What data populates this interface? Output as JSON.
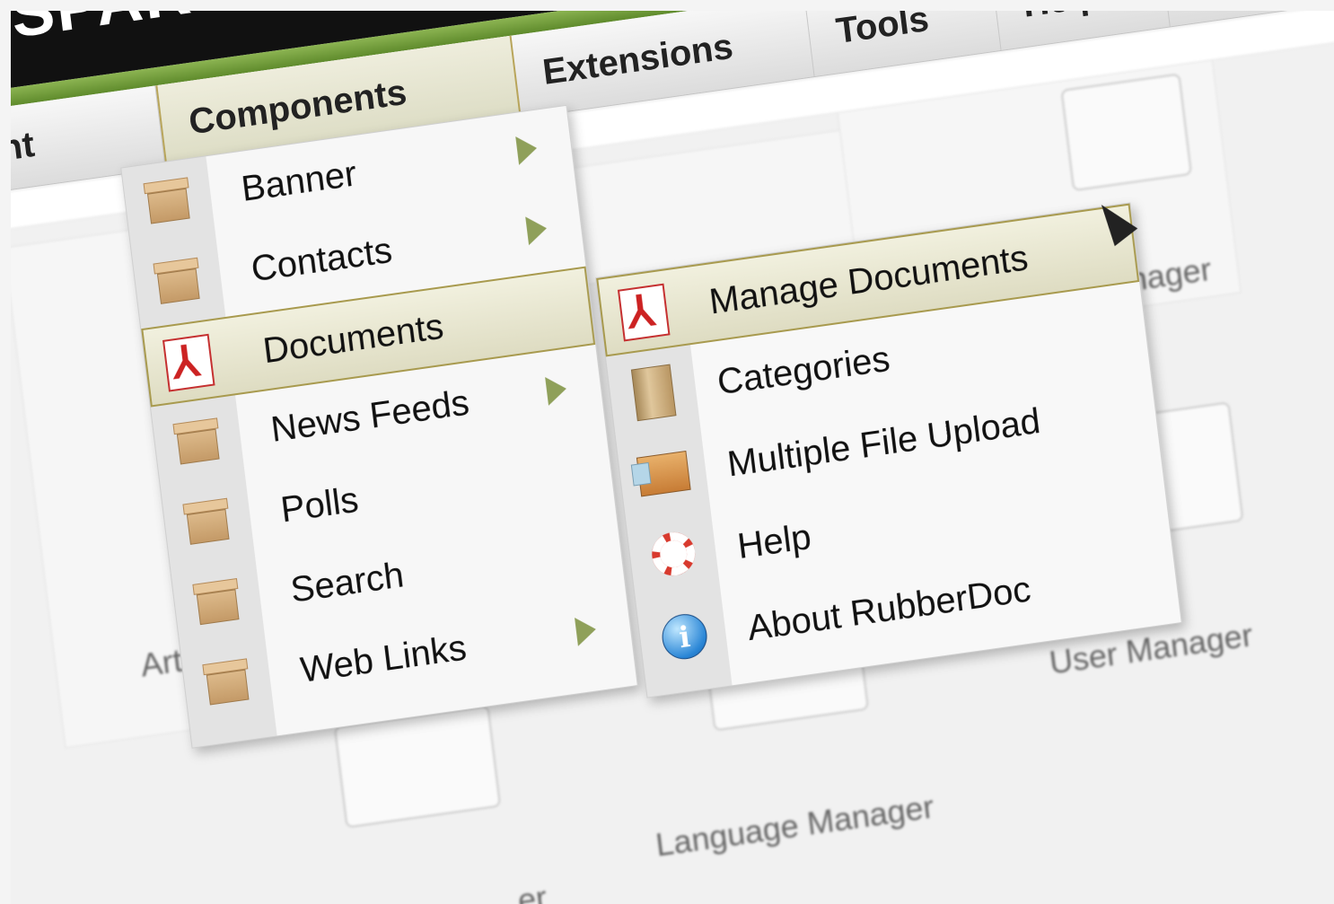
{
  "header": {
    "logo_text": "SPARC"
  },
  "menubar": {
    "items": [
      {
        "label": "nt"
      },
      {
        "label": "Components"
      },
      {
        "label": "Extensions"
      },
      {
        "label": "Tools"
      },
      {
        "label": "Help"
      }
    ]
  },
  "components_menu": {
    "items": [
      {
        "label": "Banner",
        "icon": "box-icon",
        "has_submenu": true
      },
      {
        "label": "Contacts",
        "icon": "box-icon",
        "has_submenu": true
      },
      {
        "label": "Documents",
        "icon": "pdf-icon",
        "has_submenu": true,
        "highlighted": true
      },
      {
        "label": "News Feeds",
        "icon": "box-icon",
        "has_submenu": true
      },
      {
        "label": "Polls",
        "icon": "box-icon",
        "has_submenu": false
      },
      {
        "label": "Search",
        "icon": "box-icon",
        "has_submenu": false
      },
      {
        "label": "Web Links",
        "icon": "box-icon",
        "has_submenu": true
      }
    ]
  },
  "documents_submenu": {
    "items": [
      {
        "label": "Manage Documents",
        "icon": "pdf-icon",
        "highlighted": true
      },
      {
        "label": "Categories",
        "icon": "folder-icon"
      },
      {
        "label": "Multiple File Upload",
        "icon": "upload-icon"
      },
      {
        "label": "Help",
        "icon": "lifebuoy-icon"
      },
      {
        "label": "About RubberDoc",
        "icon": "info-icon"
      }
    ]
  },
  "background": {
    "labels": {
      "article": "Artic",
      "manager_top": "anager",
      "language_manager": "Language Manager",
      "user_manager": "User Manager",
      "partial_bottom": "er"
    }
  },
  "colors": {
    "header_bg": "#111111",
    "green_bar": "#7aa443",
    "highlight_border": "#a89a4e",
    "pdf_red": "#cc2222",
    "submenu_arrow": "#8fa05a"
  }
}
